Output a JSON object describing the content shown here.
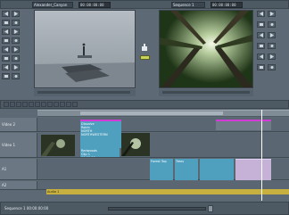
{
  "top_toolbar": {
    "source_dropdown": "Alexander_Canyon",
    "source_timecode": "00:00:00:00",
    "record_dropdown": "Sequence 1",
    "record_timecode": "00:00:00:00"
  },
  "tracks": {
    "v2_label": "Video 2",
    "v1_label": "Video 1",
    "a1_label": "A1",
    "a2_label": "A2"
  },
  "clips": {
    "v2_main_text": "Dissolve\nRobin\nNORTH\nNORTHWESTERN",
    "v1_title_text": "Redwoods\nClip 1\n00:00:00",
    "v1_b_text": "Forest Top",
    "v1_c_text": "Trees",
    "audio_label": "Audio 1"
  },
  "bottom_bar": {
    "status": "Sequence 1  00:00:00:00"
  },
  "colors": {
    "magenta": "#d23bd6",
    "cyan_clip": "#4f9fbf",
    "audio_yellow": "#c8b040"
  }
}
